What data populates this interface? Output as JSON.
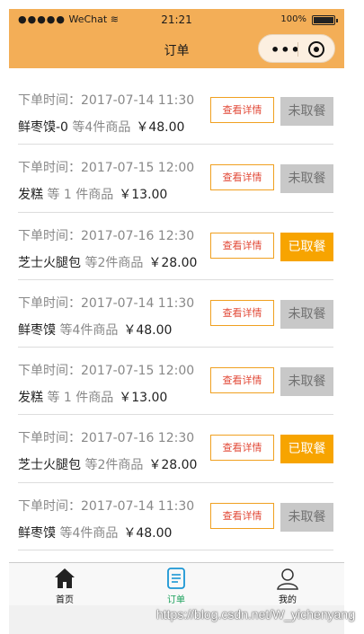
{
  "status": {
    "carrier": "WeChat",
    "signal": "●●●●●",
    "time": "21:21",
    "battery": "100%"
  },
  "navbar": {
    "title": "订单"
  },
  "orders": [
    {
      "time_label": "下单时间：",
      "time": "2017-07-14 11:30",
      "name": "鲜枣馍-0",
      "count": " 等4件商品",
      "price": "￥48.00",
      "detail_label": "查看详情",
      "status_label": "未取餐",
      "status": "pending"
    },
    {
      "time_label": "下单时间：",
      "time": "2017-07-15 12:00",
      "name": "发糕",
      "count": " 等 1 件商品",
      "price": "￥13.00",
      "detail_label": "查看详情",
      "status_label": "未取餐",
      "status": "pending"
    },
    {
      "time_label": "下单时间：",
      "time": "2017-07-16 12:30",
      "name": "芝士火腿包",
      "count": " 等2件商品",
      "price": "￥28.00",
      "detail_label": "查看详情",
      "status_label": "已取餐",
      "status": "done"
    },
    {
      "time_label": "下单时间：",
      "time": "2017-07-14 11:30",
      "name": "鲜枣馍",
      "count": " 等4件商品",
      "price": "￥48.00",
      "detail_label": "查看详情",
      "status_label": "未取餐",
      "status": "pending"
    },
    {
      "time_label": "下单时间：",
      "time": "2017-07-15 12:00",
      "name": "发糕",
      "count": " 等 1 件商品",
      "price": "￥13.00",
      "detail_label": "查看详情",
      "status_label": "未取餐",
      "status": "pending"
    },
    {
      "time_label": "下单时间：",
      "time": "2017-07-16 12:30",
      "name": "芝士火腿包",
      "count": " 等2件商品",
      "price": "￥28.00",
      "detail_label": "查看详情",
      "status_label": "已取餐",
      "status": "done"
    },
    {
      "time_label": "下单时间：",
      "time": "2017-07-14 11:30",
      "name": "鲜枣馍",
      "count": " 等4件商品",
      "price": "￥48.00",
      "detail_label": "查看详情",
      "status_label": "未取餐",
      "status": "pending"
    }
  ],
  "tabbar": {
    "home": "首页",
    "orders": "订单",
    "mine": "我的"
  },
  "watermark": "https://blog.csdn.net/W_yichenyang",
  "colors": {
    "accent": "#f3ae57",
    "done": "#f7a400",
    "active_tab": "#19a05a"
  }
}
